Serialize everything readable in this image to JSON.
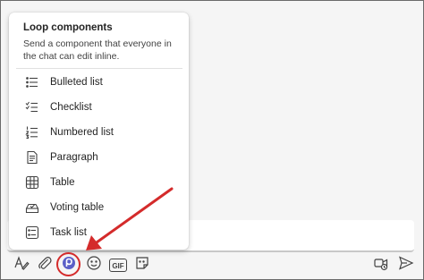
{
  "menu": {
    "title": "Loop components",
    "description": "Send a component that everyone in the chat can edit inline.",
    "items": [
      {
        "label": "Bulleted list",
        "icon": "bulleted-list-icon"
      },
      {
        "label": "Checklist",
        "icon": "checklist-icon"
      },
      {
        "label": "Numbered list",
        "icon": "numbered-list-icon"
      },
      {
        "label": "Paragraph",
        "icon": "paragraph-icon"
      },
      {
        "label": "Table",
        "icon": "table-icon"
      },
      {
        "label": "Voting table",
        "icon": "voting-table-icon"
      },
      {
        "label": "Task list",
        "icon": "task-list-icon"
      }
    ]
  },
  "toolbar": {
    "gif_label": "GIF",
    "tools": [
      "format-icon",
      "attach-icon",
      "loop-icon",
      "emoji-icon",
      "gif-icon",
      "sticker-icon"
    ],
    "right_tools": [
      "schedule-meeting-icon",
      "send-icon"
    ]
  },
  "colors": {
    "annotation_red": "#d42b2b",
    "loop_accent": "#5b5fc7"
  }
}
